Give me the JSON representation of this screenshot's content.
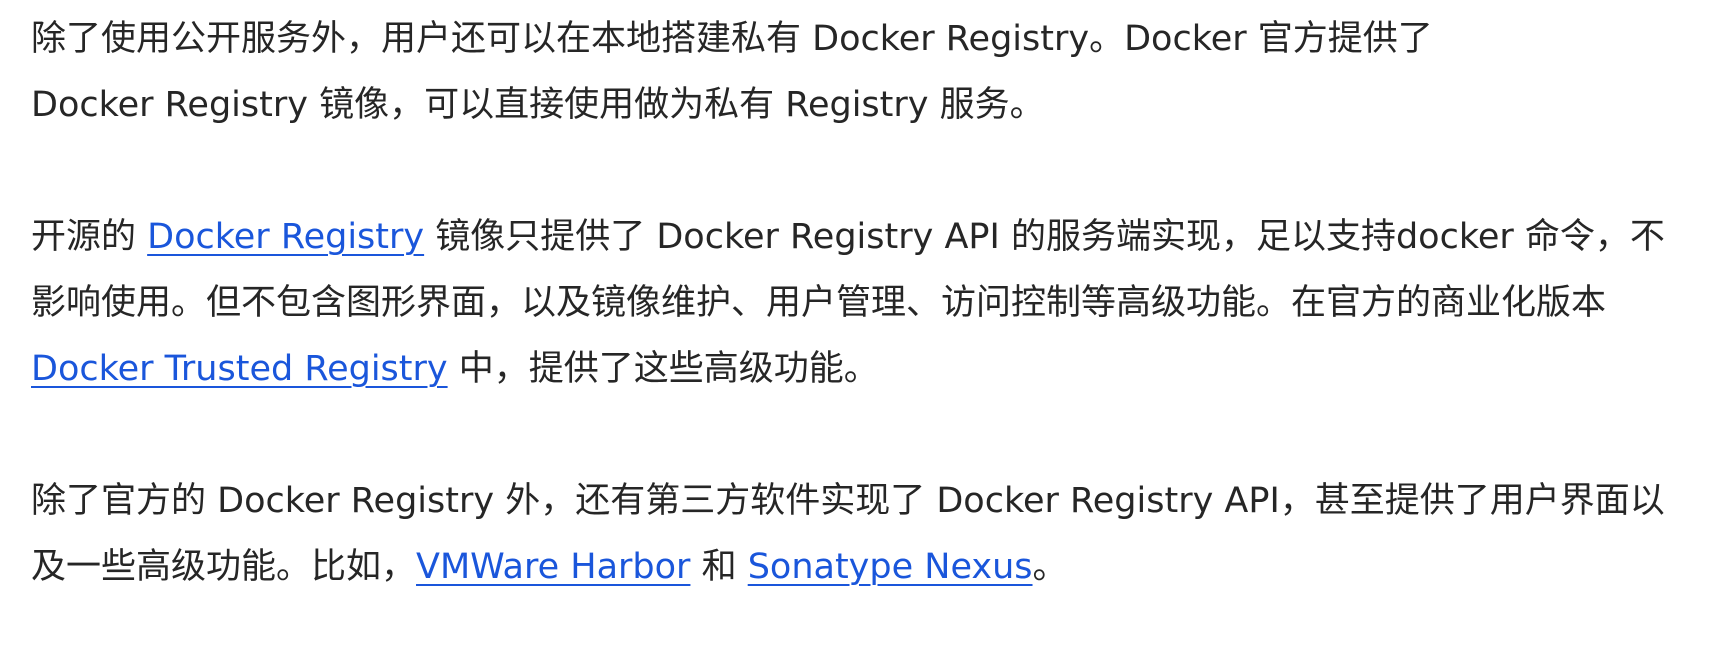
{
  "paragraphs": [
    {
      "lines": [
        {
          "text": "除了使用公开服务外，用户还可以在本地搭建私有 Docker Registry。Docker 官方提供了"
        },
        {
          "text": "Docker Registry 镜像，可以直接使用做为私有 Registry 服务。"
        }
      ]
    },
    {
      "line1": {
        "before": "开源的 ",
        "link": "Docker Registry",
        "after": " 镜像只提供了 Docker Registry API 的服务端实现，足以支持docker 命令，不"
      },
      "line2": {
        "text": "影响使用。但不包含图形界面，以及镜像维护、用户管理、访问控制等高级功能。在官方的商业化版本"
      },
      "line3": {
        "link": "Docker Trusted Registry",
        "after": " 中，提供了这些高级功能。"
      }
    },
    {
      "line1": {
        "text": "除了官方的 Docker Registry 外，还有第三方软件实现了 Docker Registry API，甚至提供了用户界面以"
      },
      "line2": {
        "before": "及一些高级功能。比如，",
        "link1": "VMWare Harbor",
        "middle": " 和 ",
        "link2": "Sonatype Nexus",
        "after": "。"
      }
    }
  ]
}
